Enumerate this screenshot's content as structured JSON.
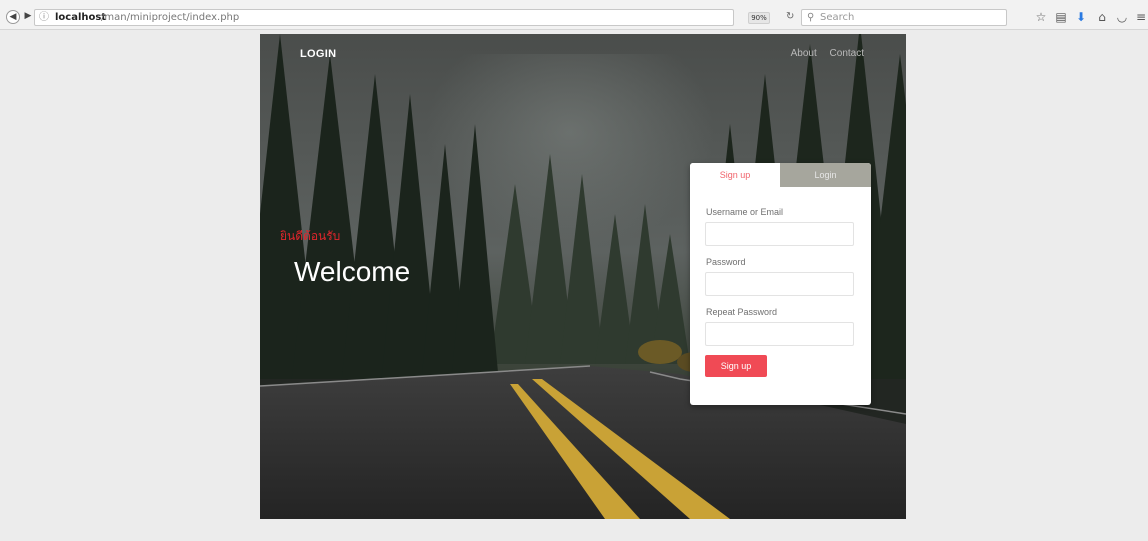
{
  "browser": {
    "url_host": "localhost",
    "url_path": "/man/miniproject/index.php",
    "zoom": "90%",
    "search_placeholder": "Search",
    "icons": [
      "back-icon",
      "forward-icon",
      "info-icon",
      "reload-icon",
      "search-icon",
      "bookmark-star-icon",
      "reading-list-icon",
      "download-icon",
      "home-icon",
      "pocket-icon",
      "menu-icon"
    ]
  },
  "site": {
    "brand": "LOGIN",
    "nav": [
      "About",
      "Contact"
    ],
    "greeting_thai": "ยินดีต้อนรับ",
    "greeting": "Welcome"
  },
  "form": {
    "tabs": [
      "Sign up",
      "Login"
    ],
    "fields": [
      {
        "label": "Username or Email",
        "value": ""
      },
      {
        "label": "Password",
        "value": ""
      },
      {
        "label": "Repeat Password",
        "value": ""
      }
    ],
    "submit": "Sign up"
  },
  "colors": {
    "accent": "#f04a55",
    "tab_active_text": "#f0636b",
    "greeting_thai": "#e0262c"
  }
}
